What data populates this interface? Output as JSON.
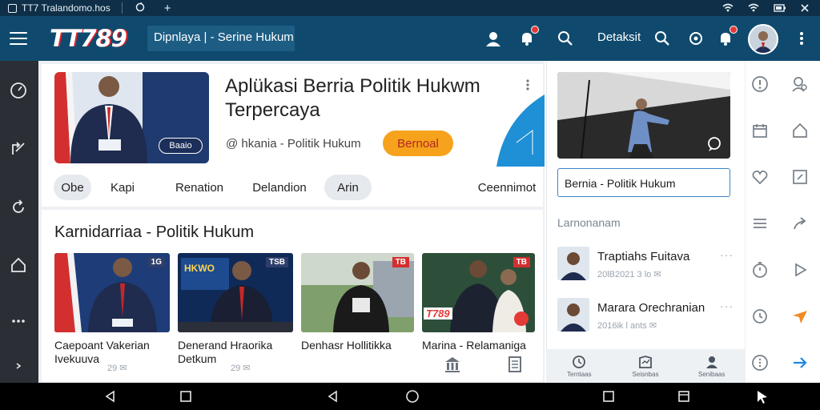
{
  "status_bar": {
    "tab_title": "TT7 Tralandomo.hos",
    "add_tab": "+"
  },
  "header": {
    "logo_text": "TT789",
    "title": "Dipnlaya | - Serine Hukum",
    "link_text": "Detaksit",
    "icons": [
      "profile-icon",
      "notification-icon",
      "search-icon",
      "search-icon",
      "settings-icon",
      "notification-icon",
      "avatar",
      "more-icon"
    ]
  },
  "hero": {
    "title": "Aplükasi Berria Politik Hukwm Terpercaya",
    "image_label": "Baaio",
    "meta": "@ hkania  -  Politik Hukum",
    "cta": "Bernoal",
    "chips": [
      "Obe",
      "Kapi",
      "Renation",
      "Delandion",
      "Arin",
      "Ceennimot"
    ]
  },
  "section": {
    "title": "Karnidarriaa - Politik Hukum",
    "cards": [
      {
        "caption_line1": "Caepoant Vakerian",
        "caption_line2": "Ivekuuva",
        "meta": "29 ✉",
        "tag": "1G"
      },
      {
        "caption_line1": "Denerand Hraorika",
        "caption_line2": "Detkum",
        "meta": "29 ✉",
        "tag": "TSB",
        "screen_text": "HKWO"
      },
      {
        "caption_line1": "Denhasr Hollitikka",
        "caption_line2": "",
        "meta": "",
        "tag": "TB"
      },
      {
        "caption_line1": "Marina - Relamaniga",
        "caption_line2": "",
        "meta": "",
        "tag": "TB",
        "logo_text": "T789"
      }
    ]
  },
  "right_panel": {
    "search_value": "Bernia - Politik Hukum",
    "section_title": "Larnonanam",
    "items": [
      {
        "title": "Traptiahs Fuitava",
        "meta": "20lB2021 3 lo ✉"
      },
      {
        "title": "Marara Orechranian",
        "meta": "2016ik l ants ✉"
      }
    ],
    "more": "···",
    "bottom_tabs": [
      "Terntaas",
      "Seisnbas",
      "Senibaas"
    ]
  },
  "colors": {
    "header_bg": "#0f4a6e",
    "status_bg": "#0e2f47",
    "cta_bg": "#f6a21d",
    "cta_text": "#b3261e",
    "accent_blue": "#3f84c4",
    "left_rail_bg": "#2b2f35"
  }
}
